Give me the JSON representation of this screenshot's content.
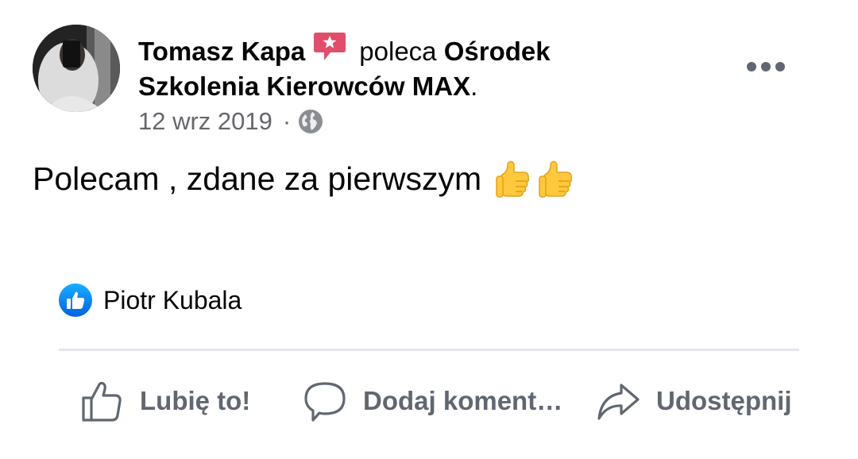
{
  "post": {
    "author": "Tomasz Kapa",
    "verb": "poleca",
    "page_line1": "Ośrodek",
    "page_line2": "Szkolenia Kierowców MAX",
    "page_suffix": ".",
    "date": "12 wrz 2019",
    "separator": "·",
    "privacy_icon": "globe-icon",
    "text": "Polecam , zdane za pierwszym",
    "emoji": [
      "thumbs-up-emoji",
      "thumbs-up-emoji"
    ]
  },
  "reactions": {
    "icon": "like-icon",
    "names": "Piotr Kubala"
  },
  "actions": {
    "like_label": "Lubię to!",
    "comment_label": "Dodaj koment…",
    "share_label": "Udostępnij"
  },
  "colors": {
    "recommend_badge": "#e04e6c",
    "like_blue": "#1877f2",
    "secondary_text": "#65676b",
    "action_text": "#606770",
    "divider": "#e4e6eb"
  }
}
